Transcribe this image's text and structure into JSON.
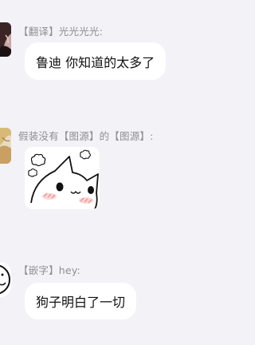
{
  "messages": [
    {
      "sender": "【翻译】光光光光:",
      "text": "鲁迪 你知道的太多了",
      "avatar_icon": "dark-anime-avatar"
    },
    {
      "sender": "假装没有【图源】的【图源】:",
      "sticker_icon": "blushing-cat-sticker",
      "avatar_icon": "anime-girl-avatar"
    },
    {
      "sender": "【嵌字】hey:",
      "text": "狗子明白了一切",
      "avatar_icon": "doodle-face-avatar"
    }
  ],
  "colors": {
    "background": "#f2f2f7",
    "bubble": "#ffffff",
    "sender_text": "#8e8e93",
    "message_text": "#111111"
  }
}
